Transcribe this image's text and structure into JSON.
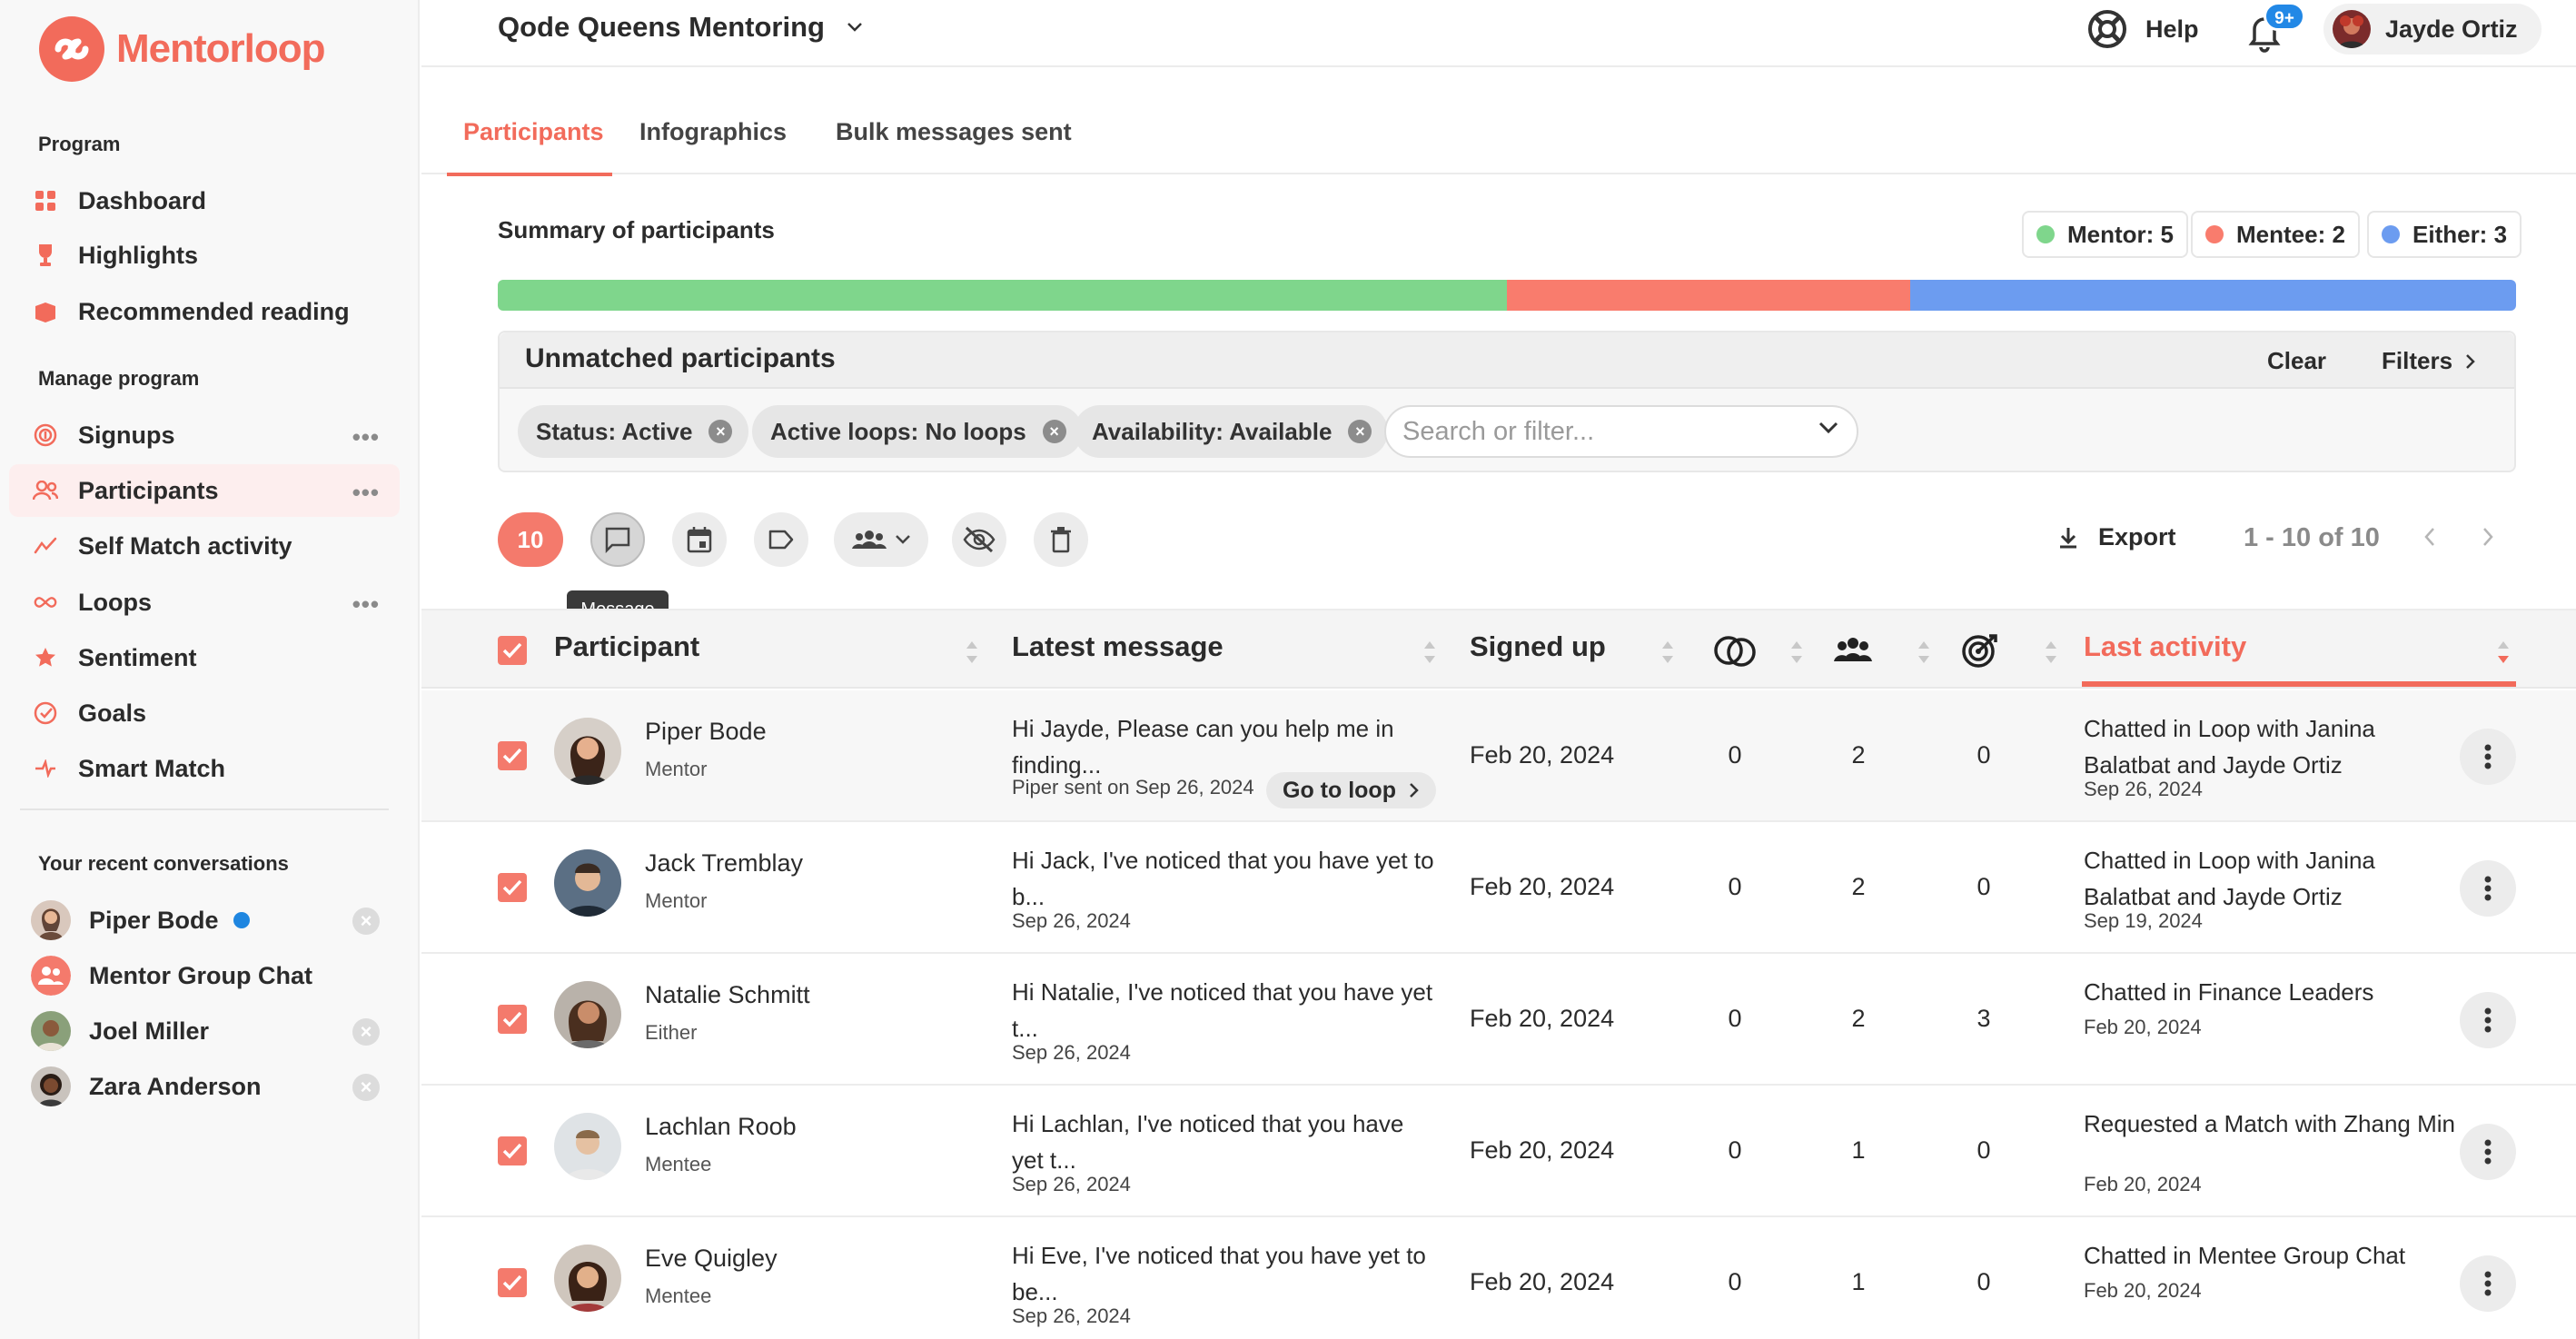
{
  "app": {
    "brand": "Mentorloop",
    "brand_color": "#f26b5b"
  },
  "sidebar": {
    "program_label": "Program",
    "program_items": [
      {
        "label": "Dashboard",
        "icon": "dashboard-icon"
      },
      {
        "label": "Highlights",
        "icon": "trophy-icon"
      },
      {
        "label": "Recommended reading",
        "icon": "book-icon"
      }
    ],
    "manage_label": "Manage program",
    "manage_items": [
      {
        "label": "Signups",
        "icon": "fingerprint-icon",
        "more": "•••"
      },
      {
        "label": "Participants",
        "icon": "people-icon",
        "more": "•••",
        "active": true
      },
      {
        "label": "Self Match activity",
        "icon": "self-match-icon"
      },
      {
        "label": "Loops",
        "icon": "infinity-icon",
        "more": "•••"
      },
      {
        "label": "Sentiment",
        "icon": "star-icon"
      },
      {
        "label": "Goals",
        "icon": "target-icon"
      },
      {
        "label": "Smart Match",
        "icon": "smart-match-icon"
      }
    ],
    "recent_label": "Your recent conversations",
    "recent": [
      {
        "name": "Piper Bode",
        "unread": true
      },
      {
        "name": "Mentor Group Chat",
        "unread": false
      },
      {
        "name": "Joel Miller",
        "unread": false
      },
      {
        "name": "Zara Anderson",
        "unread": false
      }
    ]
  },
  "topbar": {
    "program_title": "Qode Queens Mentoring",
    "help_label": "Help",
    "notification_badge": "9+",
    "user_name": "Jayde Ortiz"
  },
  "tabs": [
    {
      "label": "Participants",
      "active": true
    },
    {
      "label": "Infographics",
      "active": false
    },
    {
      "label": "Bulk messages sent",
      "active": false
    }
  ],
  "summary": {
    "title": "Summary of participants",
    "legend": [
      {
        "label": "Mentor: 5",
        "color": "#7fd68c",
        "value": 5
      },
      {
        "label": "Mentee: 2",
        "color": "#f97c6d",
        "value": 2
      },
      {
        "label": "Either: 3",
        "color": "#6c9cf0",
        "value": 3
      }
    ]
  },
  "filters": {
    "title": "Unmatched participants",
    "clear_label": "Clear",
    "filters_label": "Filters",
    "chips": [
      "Status: Active",
      "Active loops: No loops",
      "Availability: Available"
    ],
    "search_placeholder": "Search or filter..."
  },
  "toolbar": {
    "selected_count": "10",
    "tooltip": "Message",
    "export_label": "Export",
    "pager": "1 - 10 of 10"
  },
  "table": {
    "headers": {
      "participant": "Participant",
      "latest_message": "Latest message",
      "signed_up": "Signed up",
      "last_activity": "Last activity"
    },
    "rows": [
      {
        "name": "Piper Bode",
        "role": "Mentor",
        "message": "Hi Jayde, Please can you help me in finding...",
        "message_meta": "Piper sent on Sep 26, 2024",
        "go_to_loop": "Go to loop",
        "signed_up": "Feb 20, 2024",
        "loops": "0",
        "groups": "2",
        "goals": "0",
        "activity": "Chatted in Loop with Janina Balatbat and Jayde Ortiz",
        "activity_date": "Sep 26, 2024"
      },
      {
        "name": "Jack Tremblay",
        "role": "Mentor",
        "message": "Hi Jack, I've noticed that you have yet to b...",
        "message_meta": "Sep 26, 2024",
        "signed_up": "Feb 20, 2024",
        "loops": "0",
        "groups": "2",
        "goals": "0",
        "activity": "Chatted in Loop with Janina Balatbat and Jayde Ortiz",
        "activity_date": "Sep 19, 2024"
      },
      {
        "name": "Natalie Schmitt",
        "role": "Either",
        "message": "Hi Natalie, I've noticed that you have yet t...",
        "message_meta": "Sep 26, 2024",
        "signed_up": "Feb 20, 2024",
        "loops": "0",
        "groups": "2",
        "goals": "3",
        "activity": "Chatted in Finance Leaders",
        "activity_date": "Feb 20, 2024"
      },
      {
        "name": "Lachlan Roob",
        "role": "Mentee",
        "message": "Hi Lachlan, I've noticed that you have yet t...",
        "message_meta": "Sep 26, 2024",
        "signed_up": "Feb 20, 2024",
        "loops": "0",
        "groups": "1",
        "goals": "0",
        "activity": "Requested a Match with Zhang Min",
        "activity_date": "Feb 20, 2024"
      },
      {
        "name": "Eve Quigley",
        "role": "Mentee",
        "message": "Hi Eve, I've noticed that you have yet to be...",
        "message_meta": "Sep 26, 2024",
        "signed_up": "Feb 20, 2024",
        "loops": "0",
        "groups": "1",
        "goals": "0",
        "activity": "Chatted in Mentee Group Chat",
        "activity_date": "Feb 20, 2024"
      }
    ]
  }
}
